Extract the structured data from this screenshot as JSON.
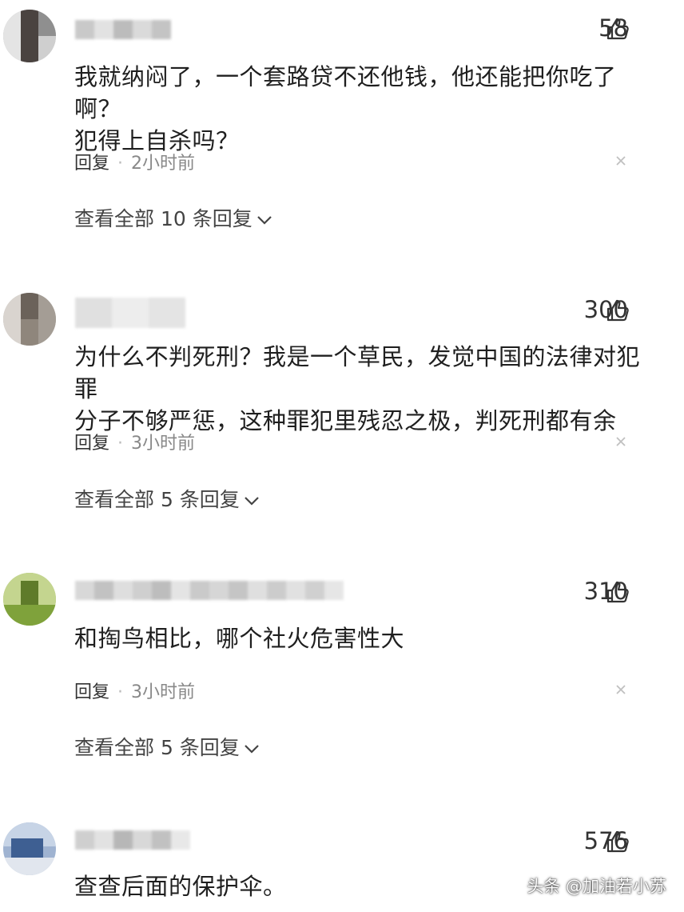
{
  "comments": [
    {
      "likes": "58",
      "text": [
        "我就纳闷了，一个套路贷不还他钱，他还能把你吃了啊？",
        "犯得上自杀吗？"
      ],
      "reply_label": "回复",
      "separator": "·",
      "time": "2小时前",
      "view_all": "查看全部 10 条回复"
    },
    {
      "likes": "300",
      "text": [
        "为什么不判死刑？我是一个草民，发觉中国的法律对犯罪",
        "分子不够严惩，这种罪犯里残忍之极，判死刑都有余"
      ],
      "reply_label": "回复",
      "separator": "·",
      "time": "3小时前",
      "view_all": "查看全部 5 条回复"
    },
    {
      "likes": "310",
      "text": [
        "和掏鸟相比，哪个社火危害性大"
      ],
      "reply_label": "回复",
      "separator": "·",
      "time": "3小时前",
      "view_all": "查看全部 5 条回复"
    },
    {
      "likes": "576",
      "text": [
        "查查后面的保护伞。"
      ]
    }
  ],
  "watermark": "头条 @加油若小苏",
  "icons": {
    "like": "thumbs-up-icon",
    "close": "close-icon",
    "expand": "chevron-down-icon"
  }
}
